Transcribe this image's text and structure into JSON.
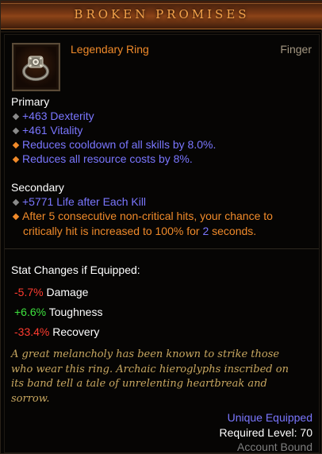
{
  "item": {
    "name": "BROKEN PROMISES",
    "type": "Legendary Ring",
    "slot": "Finger",
    "icon": "ring-icon"
  },
  "primary": {
    "label": "Primary",
    "stats": [
      {
        "text": "+463 Dexterity",
        "bullet": "gray"
      },
      {
        "text": "+461 Vitality",
        "bullet": "gray"
      },
      {
        "text": "Reduces cooldown of all skills by 8.0%.",
        "bullet": "orange"
      },
      {
        "text": "Reduces all resource costs by 8%.",
        "bullet": "orange"
      }
    ]
  },
  "secondary": {
    "label": "Secondary",
    "life_stat": "+5771 Life after Each Kill",
    "legendary_line1": "After 5 consecutive non-critical hits, your chance to",
    "legendary_line2_a": "critically hit is increased to 100% for ",
    "legendary_line2_num": "2",
    "legendary_line2_b": " seconds."
  },
  "stat_changes": {
    "title": "Stat Changes if Equipped:",
    "rows": [
      {
        "value": "-5.7%",
        "label": " Damage"
      },
      {
        "value": "+6.6%",
        "label": " Toughness"
      },
      {
        "value": "-33.4%",
        "label": " Recovery"
      }
    ]
  },
  "flavor": {
    "line1": "A great melancholy has been known to strike those",
    "line2": "who wear this ring. Archaic hieroglyphs inscribed on",
    "line3": "its band tell a tale of unrelenting heartbreak and",
    "line4": "sorrow."
  },
  "footer": {
    "unique": "Unique Equipped",
    "required_level": "Required Level: 70",
    "binding": "Account Bound"
  },
  "colors": {
    "title": "#f3a24a",
    "legendary": "#f08a2a",
    "magic_blue": "#7a76ff",
    "negative": "#ff3b30",
    "positive": "#3ee23e",
    "flavor": "#c8a760"
  }
}
